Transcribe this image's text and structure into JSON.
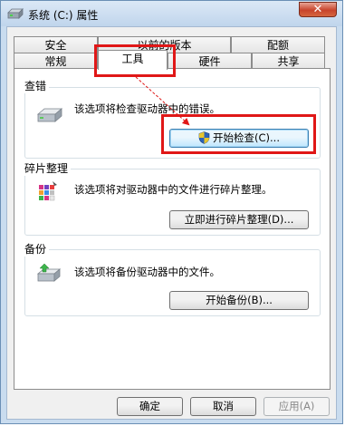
{
  "window": {
    "title": "系统 (C:) 属性",
    "close_symbol": "✕"
  },
  "tabs": {
    "row_back": [
      "安全",
      "以前的版本",
      "配额"
    ],
    "row_front": [
      "常规",
      "工具",
      "硬件",
      "共享"
    ],
    "active": "工具"
  },
  "error_checking": {
    "title": "查错",
    "description": "该选项将检查驱动器中的错误。",
    "button_label": "开始检查(C)...",
    "button_icon": "uac-shield-icon"
  },
  "defrag": {
    "title": "碎片整理",
    "description": "该选项将对驱动器中的文件进行碎片整理。",
    "button_label": "立即进行碎片整理(D)..."
  },
  "backup": {
    "title": "备份",
    "description": "该选项将备份驱动器中的文件。",
    "button_label": "开始备份(B)..."
  },
  "footer": {
    "ok_label": "确定",
    "cancel_label": "取消",
    "apply_label": "应用(A)"
  },
  "colors": {
    "highlight": "#e01717",
    "window_frame": "#c9dcef",
    "focus_button": "#bee6fd"
  }
}
